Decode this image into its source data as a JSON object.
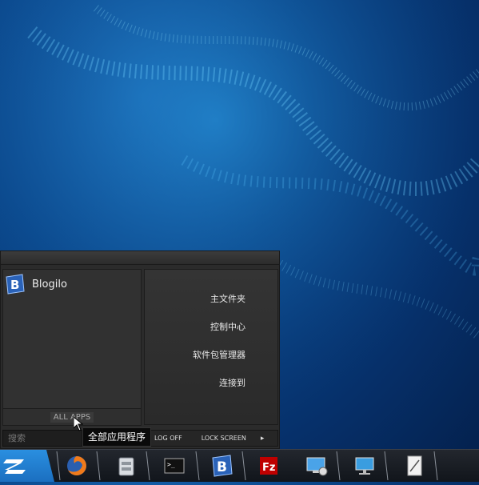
{
  "start_menu": {
    "apps": [
      {
        "label": "Blogilo",
        "icon": "blogilo-icon"
      }
    ],
    "all_apps_label": "ALL APPS",
    "places": [
      "主文件夹",
      "控制中心",
      "软件包管理器",
      "连接到"
    ],
    "search_placeholder": "搜索",
    "log_off_label": "LOG OFF",
    "lock_screen_label": "LOCK SCREEN",
    "arrow": "▸"
  },
  "tooltip": "全部应用程序",
  "taskbar": {
    "items": [
      "firefox-icon",
      "file-manager-icon",
      "terminal-icon",
      "blogilo-icon",
      "filezilla-icon",
      "remote-desktop-icon",
      "network-monitor-icon",
      "text-editor-icon"
    ]
  },
  "colors": {
    "accent": "#2a8fe0",
    "menu_bg": "#2b2b2b"
  }
}
